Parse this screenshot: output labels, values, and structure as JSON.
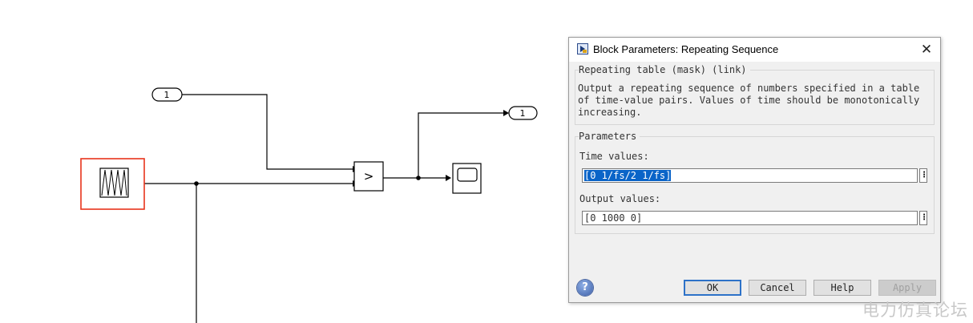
{
  "diagram": {
    "inport_label": "1",
    "relational_operator": ">",
    "outport_label": "1",
    "highlight_color": "#e8341c"
  },
  "dialog": {
    "title": "Block Parameters: Repeating Sequence",
    "close_glyph": "✕",
    "mask_group_title": "Repeating table (mask) (link)",
    "description": "Output a repeating sequence of numbers specified in a table of time-value pairs. Values of time should be monotonically increasing.",
    "params_group_title": "Parameters",
    "time_values_label": "Time values:",
    "time_values_value": "[0 1/fs/2 1/fs]",
    "output_values_label": "Output values:",
    "output_values_value": "[0 1000 0]",
    "more_glyph": "⋮",
    "help_glyph": "?",
    "buttons": {
      "ok": "OK",
      "cancel": "Cancel",
      "help": "Help",
      "apply": "Apply"
    }
  },
  "watermark": "电力仿真论坛"
}
